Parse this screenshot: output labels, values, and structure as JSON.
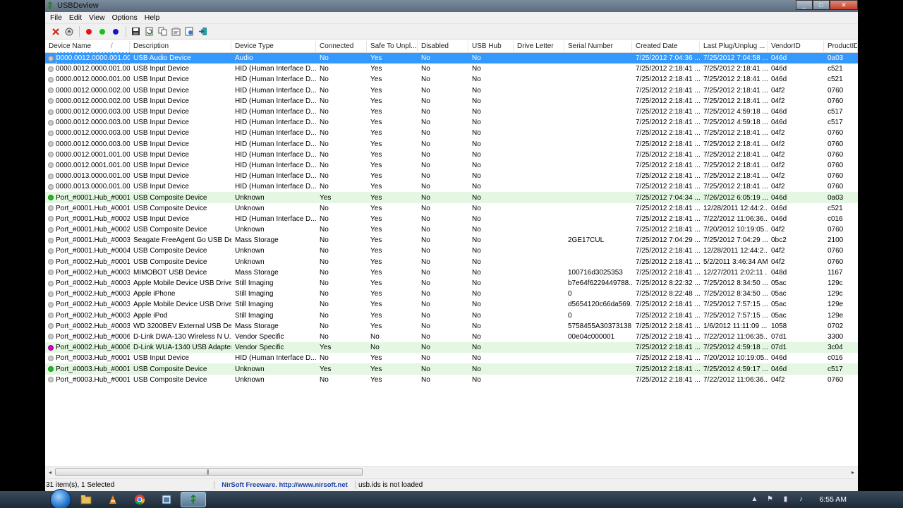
{
  "window": {
    "title": "USBDeview"
  },
  "menu": [
    "File",
    "Edit",
    "View",
    "Options",
    "Help"
  ],
  "toolbar_icons": [
    "uninstall-icon",
    "eject-icon",
    "disable-icon",
    "enable-icon",
    "enable-disable-icon",
    "save-icon",
    "refresh-icon",
    "copy-icon",
    "properties-icon",
    "html-report-icon",
    "exit-icon"
  ],
  "columns": [
    "Device Name",
    "Description",
    "Device Type",
    "Connected",
    "Safe To Unpl...",
    "Disabled",
    "USB Hub",
    "Drive Letter",
    "Serial Number",
    "Created Date",
    "Last Plug/Unplug ...",
    "VendorID",
    "ProductID"
  ],
  "sort_indicator": "/",
  "rows": [
    {
      "name": "0000.0012.0000.001.00...",
      "desc": "USB Audio Device",
      "type": "Audio",
      "connected": "No",
      "safe": "Yes",
      "disabled": "No",
      "hub": "No",
      "drive": "",
      "serial": "",
      "created": "7/25/2012 7:04:36 ...",
      "last": "7/25/2012 7:04:58 ...",
      "vid": "046d",
      "pid": "0a03",
      "state": "gray",
      "selected": true
    },
    {
      "name": "0000.0012.0000.001.00...",
      "desc": "USB Input Device",
      "type": "HID (Human Interface D...",
      "connected": "No",
      "safe": "Yes",
      "disabled": "No",
      "hub": "No",
      "drive": "",
      "serial": "",
      "created": "7/25/2012 2:18:41 ...",
      "last": "7/25/2012 2:18:41 ...",
      "vid": "046d",
      "pid": "c521",
      "state": "gray"
    },
    {
      "name": "0000.0012.0000.001.00...",
      "desc": "USB Input Device",
      "type": "HID (Human Interface D...",
      "connected": "No",
      "safe": "Yes",
      "disabled": "No",
      "hub": "No",
      "drive": "",
      "serial": "",
      "created": "7/25/2012 2:18:41 ...",
      "last": "7/25/2012 2:18:41 ...",
      "vid": "046d",
      "pid": "c521",
      "state": "gray"
    },
    {
      "name": "0000.0012.0000.002.00...",
      "desc": "USB Input Device",
      "type": "HID (Human Interface D...",
      "connected": "No",
      "safe": "Yes",
      "disabled": "No",
      "hub": "No",
      "drive": "",
      "serial": "",
      "created": "7/25/2012 2:18:41 ...",
      "last": "7/25/2012 2:18:41 ...",
      "vid": "04f2",
      "pid": "0760",
      "state": "gray"
    },
    {
      "name": "0000.0012.0000.002.00...",
      "desc": "USB Input Device",
      "type": "HID (Human Interface D...",
      "connected": "No",
      "safe": "Yes",
      "disabled": "No",
      "hub": "No",
      "drive": "",
      "serial": "",
      "created": "7/25/2012 2:18:41 ...",
      "last": "7/25/2012 2:18:41 ...",
      "vid": "04f2",
      "pid": "0760",
      "state": "gray"
    },
    {
      "name": "0000.0012.0000.003.00...",
      "desc": "USB Input Device",
      "type": "HID (Human Interface D...",
      "connected": "No",
      "safe": "Yes",
      "disabled": "No",
      "hub": "No",
      "drive": "",
      "serial": "",
      "created": "7/25/2012 2:18:41 ...",
      "last": "7/25/2012 4:59:18 ...",
      "vid": "046d",
      "pid": "c517",
      "state": "gray"
    },
    {
      "name": "0000.0012.0000.003.00...",
      "desc": "USB Input Device",
      "type": "HID (Human Interface D...",
      "connected": "No",
      "safe": "Yes",
      "disabled": "No",
      "hub": "No",
      "drive": "",
      "serial": "",
      "created": "7/25/2012 2:18:41 ...",
      "last": "7/25/2012 4:59:18 ...",
      "vid": "046d",
      "pid": "c517",
      "state": "gray"
    },
    {
      "name": "0000.0012.0000.003.00...",
      "desc": "USB Input Device",
      "type": "HID (Human Interface D...",
      "connected": "No",
      "safe": "Yes",
      "disabled": "No",
      "hub": "No",
      "drive": "",
      "serial": "",
      "created": "7/25/2012 2:18:41 ...",
      "last": "7/25/2012 2:18:41 ...",
      "vid": "04f2",
      "pid": "0760",
      "state": "gray"
    },
    {
      "name": "0000.0012.0000.003.00...",
      "desc": "USB Input Device",
      "type": "HID (Human Interface D...",
      "connected": "No",
      "safe": "Yes",
      "disabled": "No",
      "hub": "No",
      "drive": "",
      "serial": "",
      "created": "7/25/2012 2:18:41 ...",
      "last": "7/25/2012 2:18:41 ...",
      "vid": "04f2",
      "pid": "0760",
      "state": "gray"
    },
    {
      "name": "0000.0012.0001.001.00...",
      "desc": "USB Input Device",
      "type": "HID (Human Interface D...",
      "connected": "No",
      "safe": "Yes",
      "disabled": "No",
      "hub": "No",
      "drive": "",
      "serial": "",
      "created": "7/25/2012 2:18:41 ...",
      "last": "7/25/2012 2:18:41 ...",
      "vid": "04f2",
      "pid": "0760",
      "state": "gray"
    },
    {
      "name": "0000.0012.0001.001.00...",
      "desc": "USB Input Device",
      "type": "HID (Human Interface D...",
      "connected": "No",
      "safe": "Yes",
      "disabled": "No",
      "hub": "No",
      "drive": "",
      "serial": "",
      "created": "7/25/2012 2:18:41 ...",
      "last": "7/25/2012 2:18:41 ...",
      "vid": "04f2",
      "pid": "0760",
      "state": "gray"
    },
    {
      "name": "0000.0013.0000.001.00...",
      "desc": "USB Input Device",
      "type": "HID (Human Interface D...",
      "connected": "No",
      "safe": "Yes",
      "disabled": "No",
      "hub": "No",
      "drive": "",
      "serial": "",
      "created": "7/25/2012 2:18:41 ...",
      "last": "7/25/2012 2:18:41 ...",
      "vid": "04f2",
      "pid": "0760",
      "state": "gray"
    },
    {
      "name": "0000.0013.0000.001.00...",
      "desc": "USB Input Device",
      "type": "HID (Human Interface D...",
      "connected": "No",
      "safe": "Yes",
      "disabled": "No",
      "hub": "No",
      "drive": "",
      "serial": "",
      "created": "7/25/2012 2:18:41 ...",
      "last": "7/25/2012 2:18:41 ...",
      "vid": "04f2",
      "pid": "0760",
      "state": "gray"
    },
    {
      "name": "Port_#0001.Hub_#0001",
      "desc": "USB Composite Device",
      "type": "Unknown",
      "connected": "Yes",
      "safe": "Yes",
      "disabled": "No",
      "hub": "No",
      "drive": "",
      "serial": "",
      "created": "7/25/2012 7:04:34 ...",
      "last": "7/26/2012 6:05:19 ...",
      "vid": "046d",
      "pid": "0a03",
      "state": "green"
    },
    {
      "name": "Port_#0001.Hub_#0001",
      "desc": "USB Composite Device",
      "type": "Unknown",
      "connected": "No",
      "safe": "Yes",
      "disabled": "No",
      "hub": "No",
      "drive": "",
      "serial": "",
      "created": "7/25/2012 2:18:41 ...",
      "last": "12/28/2011 12:44:2...",
      "vid": "046d",
      "pid": "c521",
      "state": "gray"
    },
    {
      "name": "Port_#0001.Hub_#0002",
      "desc": "USB Input Device",
      "type": "HID (Human Interface D...",
      "connected": "No",
      "safe": "Yes",
      "disabled": "No",
      "hub": "No",
      "drive": "",
      "serial": "",
      "created": "7/25/2012 2:18:41 ...",
      "last": "7/22/2012 11:06:36...",
      "vid": "046d",
      "pid": "c016",
      "state": "gray"
    },
    {
      "name": "Port_#0001.Hub_#0002",
      "desc": "USB Composite Device",
      "type": "Unknown",
      "connected": "No",
      "safe": "Yes",
      "disabled": "No",
      "hub": "No",
      "drive": "",
      "serial": "",
      "created": "7/25/2012 2:18:41 ...",
      "last": "7/20/2012 10:19:05...",
      "vid": "04f2",
      "pid": "0760",
      "state": "gray"
    },
    {
      "name": "Port_#0001.Hub_#0003",
      "desc": "Seagate FreeAgent Go USB De...",
      "type": "Mass Storage",
      "connected": "No",
      "safe": "Yes",
      "disabled": "No",
      "hub": "No",
      "drive": "",
      "serial": "2GE17CUL",
      "created": "7/25/2012 7:04:29 ...",
      "last": "7/25/2012 7:04:29 ...",
      "vid": "0bc2",
      "pid": "2100",
      "state": "gray"
    },
    {
      "name": "Port_#0001.Hub_#0004",
      "desc": "USB Composite Device",
      "type": "Unknown",
      "connected": "No",
      "safe": "Yes",
      "disabled": "No",
      "hub": "No",
      "drive": "",
      "serial": "",
      "created": "7/25/2012 2:18:41 ...",
      "last": "12/28/2011 12:44:2...",
      "vid": "04f2",
      "pid": "0760",
      "state": "gray"
    },
    {
      "name": "Port_#0002.Hub_#0001",
      "desc": "USB Composite Device",
      "type": "Unknown",
      "connected": "No",
      "safe": "Yes",
      "disabled": "No",
      "hub": "No",
      "drive": "",
      "serial": "",
      "created": "7/25/2012 2:18:41 ...",
      "last": "5/2/2011 3:46:34 AM",
      "vid": "04f2",
      "pid": "0760",
      "state": "gray"
    },
    {
      "name": "Port_#0002.Hub_#0003",
      "desc": "MIMOBOT USB Device",
      "type": "Mass Storage",
      "connected": "No",
      "safe": "Yes",
      "disabled": "No",
      "hub": "No",
      "drive": "",
      "serial": "100716d3025353",
      "created": "7/25/2012 2:18:41 ...",
      "last": "12/27/2011 2:02:11 ...",
      "vid": "048d",
      "pid": "1167",
      "state": "gray"
    },
    {
      "name": "Port_#0002.Hub_#0003",
      "desc": "Apple Mobile Device USB Driver",
      "type": "Still Imaging",
      "connected": "No",
      "safe": "Yes",
      "disabled": "No",
      "hub": "No",
      "drive": "",
      "serial": "b7e64f6229449788...",
      "created": "7/25/2012 8:22:32 ...",
      "last": "7/25/2012 8:34:50 ...",
      "vid": "05ac",
      "pid": "129c",
      "state": "gray"
    },
    {
      "name": "Port_#0002.Hub_#0003",
      "desc": "Apple iPhone",
      "type": "Still Imaging",
      "connected": "No",
      "safe": "Yes",
      "disabled": "No",
      "hub": "No",
      "drive": "",
      "serial": "0",
      "created": "7/25/2012 8:22:48 ...",
      "last": "7/25/2012 8:34:50 ...",
      "vid": "05ac",
      "pid": "129c",
      "state": "gray"
    },
    {
      "name": "Port_#0002.Hub_#0003",
      "desc": "Apple Mobile Device USB Driver",
      "type": "Still Imaging",
      "connected": "No",
      "safe": "Yes",
      "disabled": "No",
      "hub": "No",
      "drive": "",
      "serial": "d5654120c66da569...",
      "created": "7/25/2012 2:18:41 ...",
      "last": "7/25/2012 7:57:15 ...",
      "vid": "05ac",
      "pid": "129e",
      "state": "gray"
    },
    {
      "name": "Port_#0002.Hub_#0003",
      "desc": "Apple iPod",
      "type": "Still Imaging",
      "connected": "No",
      "safe": "Yes",
      "disabled": "No",
      "hub": "No",
      "drive": "",
      "serial": "0",
      "created": "7/25/2012 2:18:41 ...",
      "last": "7/25/2012 7:57:15 ...",
      "vid": "05ac",
      "pid": "129e",
      "state": "gray"
    },
    {
      "name": "Port_#0002.Hub_#0003",
      "desc": "WD 3200BEV External USB Dev...",
      "type": "Mass Storage",
      "connected": "No",
      "safe": "Yes",
      "disabled": "No",
      "hub": "No",
      "drive": "",
      "serial": "5758455A30373138...",
      "created": "7/25/2012 2:18:41 ...",
      "last": "1/6/2012 11:11:09 ...",
      "vid": "1058",
      "pid": "0702",
      "state": "gray"
    },
    {
      "name": "Port_#0002.Hub_#0006",
      "desc": "D-Link DWA-130 Wireless N U...",
      "type": "Vendor Specific",
      "connected": "No",
      "safe": "No",
      "disabled": "No",
      "hub": "No",
      "drive": "",
      "serial": "00e04c000001",
      "created": "7/25/2012 2:18:41 ...",
      "last": "7/22/2012 11:06:35...",
      "vid": "07d1",
      "pid": "3300",
      "state": "gray"
    },
    {
      "name": "Port_#0002.Hub_#0006",
      "desc": "D-Link WUA-1340 USB Adapter",
      "type": "Vendor Specific",
      "connected": "Yes",
      "safe": "No",
      "disabled": "No",
      "hub": "No",
      "drive": "",
      "serial": "",
      "created": "7/25/2012 2:18:41 ...",
      "last": "7/25/2012 4:59:18 ...",
      "vid": "07d1",
      "pid": "3c04",
      "state": "magenta"
    },
    {
      "name": "Port_#0003.Hub_#0001",
      "desc": "USB Input Device",
      "type": "HID (Human Interface D...",
      "connected": "No",
      "safe": "Yes",
      "disabled": "No",
      "hub": "No",
      "drive": "",
      "serial": "",
      "created": "7/25/2012 2:18:41 ...",
      "last": "7/20/2012 10:19:05...",
      "vid": "046d",
      "pid": "c016",
      "state": "gray"
    },
    {
      "name": "Port_#0003.Hub_#0001",
      "desc": "USB Composite Device",
      "type": "Unknown",
      "connected": "Yes",
      "safe": "Yes",
      "disabled": "No",
      "hub": "No",
      "drive": "",
      "serial": "",
      "created": "7/25/2012 2:18:41 ...",
      "last": "7/25/2012 4:59:17 ...",
      "vid": "046d",
      "pid": "c517",
      "state": "green"
    },
    {
      "name": "Port_#0003.Hub_#0001",
      "desc": "USB Composite Device",
      "type": "Unknown",
      "connected": "No",
      "safe": "Yes",
      "disabled": "No",
      "hub": "No",
      "drive": "",
      "serial": "",
      "created": "7/25/2012 2:18:41 ...",
      "last": "7/22/2012 11:06:36...",
      "vid": "04f2",
      "pid": "0760",
      "state": "gray"
    }
  ],
  "status": {
    "count": "31 item(s), 1 Selected",
    "link": "NirSoft Freeware.  http://www.nirsoft.net",
    "message": "usb.ids is not loaded"
  },
  "taskbar": {
    "clock": "6:55 AM",
    "apps": [
      "explorer-icon",
      "vlc-icon",
      "chrome-icon",
      "app-window-icon",
      "usbdeview-icon"
    ]
  },
  "colors": {
    "selected": "#3399ff",
    "connected_row": "#e4f7e2",
    "dot_gray": "#c9c9c9",
    "dot_green": "#22bb22",
    "dot_magenta": "#d000c8"
  }
}
